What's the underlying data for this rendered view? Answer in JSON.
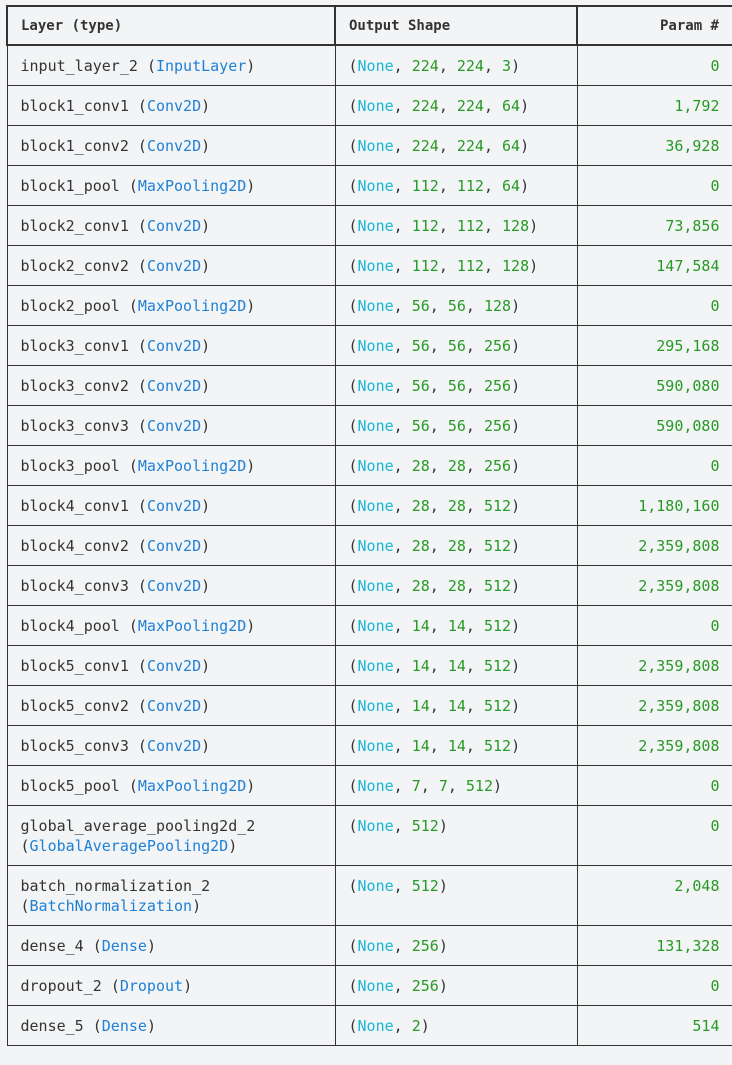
{
  "headers": {
    "layer": "Layer (type)",
    "shape": "Output Shape",
    "param": "Param #"
  },
  "rows": [
    {
      "name": "input_layer_2",
      "type": "InputLayer",
      "shape": [
        "224",
        "224",
        "3"
      ],
      "params": "0"
    },
    {
      "name": "block1_conv1",
      "type": "Conv2D",
      "shape": [
        "224",
        "224",
        "64"
      ],
      "params": "1,792"
    },
    {
      "name": "block1_conv2",
      "type": "Conv2D",
      "shape": [
        "224",
        "224",
        "64"
      ],
      "params": "36,928"
    },
    {
      "name": "block1_pool",
      "type": "MaxPooling2D",
      "shape": [
        "112",
        "112",
        "64"
      ],
      "params": "0"
    },
    {
      "name": "block2_conv1",
      "type": "Conv2D",
      "shape": [
        "112",
        "112",
        "128"
      ],
      "params": "73,856"
    },
    {
      "name": "block2_conv2",
      "type": "Conv2D",
      "shape": [
        "112",
        "112",
        "128"
      ],
      "params": "147,584"
    },
    {
      "name": "block2_pool",
      "type": "MaxPooling2D",
      "shape": [
        "56",
        "56",
        "128"
      ],
      "params": "0"
    },
    {
      "name": "block3_conv1",
      "type": "Conv2D",
      "shape": [
        "56",
        "56",
        "256"
      ],
      "params": "295,168"
    },
    {
      "name": "block3_conv2",
      "type": "Conv2D",
      "shape": [
        "56",
        "56",
        "256"
      ],
      "params": "590,080"
    },
    {
      "name": "block3_conv3",
      "type": "Conv2D",
      "shape": [
        "56",
        "56",
        "256"
      ],
      "params": "590,080"
    },
    {
      "name": "block3_pool",
      "type": "MaxPooling2D",
      "shape": [
        "28",
        "28",
        "256"
      ],
      "params": "0"
    },
    {
      "name": "block4_conv1",
      "type": "Conv2D",
      "shape": [
        "28",
        "28",
        "512"
      ],
      "params": "1,180,160"
    },
    {
      "name": "block4_conv2",
      "type": "Conv2D",
      "shape": [
        "28",
        "28",
        "512"
      ],
      "params": "2,359,808"
    },
    {
      "name": "block4_conv3",
      "type": "Conv2D",
      "shape": [
        "28",
        "28",
        "512"
      ],
      "params": "2,359,808"
    },
    {
      "name": "block4_pool",
      "type": "MaxPooling2D",
      "shape": [
        "14",
        "14",
        "512"
      ],
      "params": "0"
    },
    {
      "name": "block5_conv1",
      "type": "Conv2D",
      "shape": [
        "14",
        "14",
        "512"
      ],
      "params": "2,359,808"
    },
    {
      "name": "block5_conv2",
      "type": "Conv2D",
      "shape": [
        "14",
        "14",
        "512"
      ],
      "params": "2,359,808"
    },
    {
      "name": "block5_conv3",
      "type": "Conv2D",
      "shape": [
        "14",
        "14",
        "512"
      ],
      "params": "2,359,808"
    },
    {
      "name": "block5_pool",
      "type": "MaxPooling2D",
      "shape": [
        "7",
        "7",
        "512"
      ],
      "params": "0"
    },
    {
      "name": "global_average_pooling2d_2",
      "type": "GlobalAveragePooling2D",
      "shape": [
        "512"
      ],
      "params": "0",
      "wrap": true
    },
    {
      "name": "batch_normalization_2",
      "type": "BatchNormalization",
      "shape": [
        "512"
      ],
      "params": "2,048",
      "wrap": true
    },
    {
      "name": "dense_4",
      "type": "Dense",
      "shape": [
        "256"
      ],
      "params": "131,328"
    },
    {
      "name": "dropout_2",
      "type": "Dropout",
      "shape": [
        "256"
      ],
      "params": "0"
    },
    {
      "name": "dense_5",
      "type": "Dense",
      "shape": [
        "2"
      ],
      "params": "514"
    }
  ],
  "tokens": {
    "none": "None",
    "open": "(",
    "close": ")",
    "sep": ", "
  },
  "colors": {
    "type": "#1e80d6",
    "none": "#1bb6d6",
    "number": "#259a24"
  }
}
